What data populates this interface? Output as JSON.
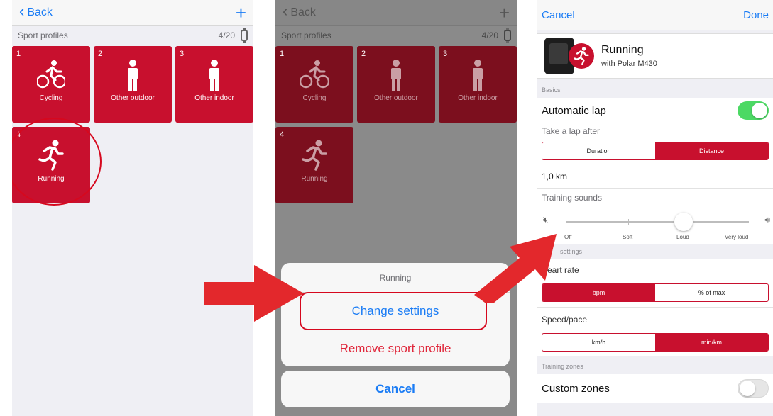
{
  "screen1": {
    "back_label": "Back",
    "section_title": "Sport profiles",
    "count": "4/20",
    "tiles": [
      {
        "num": "1",
        "label": "Cycling"
      },
      {
        "num": "2",
        "label": "Other outdoor"
      },
      {
        "num": "3",
        "label": "Other indoor"
      },
      {
        "num": "4",
        "label": "Running"
      }
    ]
  },
  "screen2": {
    "back_label": "Back",
    "section_title": "Sport profiles",
    "count": "4/20",
    "tiles": [
      {
        "num": "1",
        "label": "Cycling"
      },
      {
        "num": "2",
        "label": "Other outdoor"
      },
      {
        "num": "3",
        "label": "Other indoor"
      },
      {
        "num": "4",
        "label": "Running"
      }
    ],
    "sheet": {
      "title": "Running",
      "change_label": "Change settings",
      "remove_label": "Remove sport profile",
      "cancel_label": "Cancel"
    }
  },
  "screen3": {
    "cancel_label": "Cancel",
    "done_label": "Done",
    "device_name": "Running",
    "device_sub": "with Polar M430",
    "basics_label": "Basics",
    "auto_lap_label": "Automatic lap",
    "take_lap_label": "Take a lap after",
    "lap_seg": [
      "Duration",
      "Distance"
    ],
    "lap_value": "1,0 km",
    "training_sounds_label": "Training sounds",
    "sound_levels": [
      "Off",
      "Soft",
      "Loud",
      "Very loud"
    ],
    "settings_label": "settings",
    "heart_rate_label": "eart rate",
    "hr_seg": [
      "bpm",
      "% of max"
    ],
    "speed_label": "Speed/pace",
    "speed_seg": [
      "km/h",
      "min/km"
    ],
    "zones_group_label": "Training zones",
    "custom_zones_label": "Custom zones"
  },
  "colors": {
    "accent": "#1a7cf5",
    "brand_red": "#c8102e",
    "toggle_on": "#4cd964"
  }
}
